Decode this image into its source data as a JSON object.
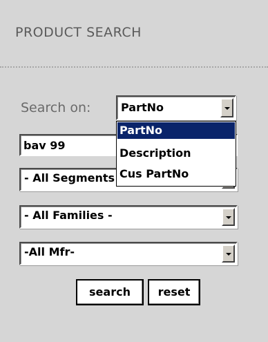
{
  "panel": {
    "title": "PRODUCT SEARCH"
  },
  "search_on": {
    "label": "Search on:",
    "selected": "PartNo",
    "options": [
      "PartNo",
      "Description",
      "Cus PartNo"
    ]
  },
  "query": {
    "value": "bav 99"
  },
  "segments": {
    "selected": "- All Segments -"
  },
  "families": {
    "selected": "- All Families -"
  },
  "manufacturer": {
    "selected": "-All Mfr-"
  },
  "buttons": {
    "search_label": "search",
    "reset_label": "reset"
  },
  "colors": {
    "panel_bg": "#d6d6d6",
    "highlight": "#0a246a"
  }
}
